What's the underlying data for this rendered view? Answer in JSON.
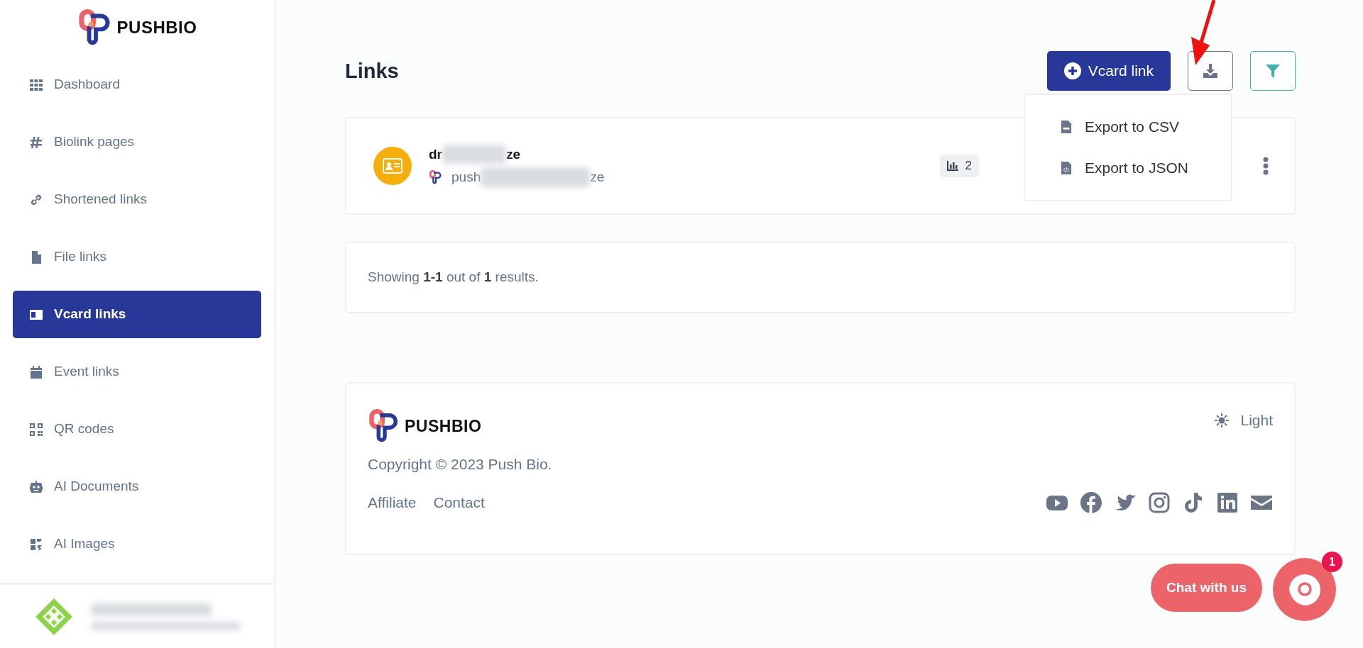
{
  "brand": "PUSHBIO",
  "sidebar": {
    "items": [
      {
        "label": "Dashboard",
        "selected": false
      },
      {
        "label": "Biolink pages",
        "selected": false
      },
      {
        "label": "Shortened links",
        "selected": false
      },
      {
        "label": "File links",
        "selected": false
      },
      {
        "label": "Vcard links",
        "selected": true
      },
      {
        "label": "Event links",
        "selected": false
      },
      {
        "label": "QR codes",
        "selected": false
      },
      {
        "label": "AI Documents",
        "selected": false
      },
      {
        "label": "AI Images",
        "selected": false
      }
    ]
  },
  "page": {
    "title": "Links"
  },
  "actions": {
    "create_label": "Vcard link",
    "export_menu": {
      "open": true,
      "items": [
        {
          "label": "Export to CSV",
          "kind": "csv"
        },
        {
          "label": "Export to JSON",
          "kind": "json"
        }
      ]
    }
  },
  "links": [
    {
      "title_start": "dr",
      "title_end": "ze",
      "url_start": "push",
      "url_end": "ze",
      "stats": "2"
    }
  ],
  "pagination": "Showing **1-1** out of **1** results.",
  "footer": {
    "brand": "PUSHBIO",
    "copyright": "Copyright © 2023 Push Bio.",
    "theme": "Light",
    "links": [
      "Affiliate",
      "Contact"
    ]
  },
  "chat": {
    "label": "Chat with us",
    "badge": "1"
  }
}
